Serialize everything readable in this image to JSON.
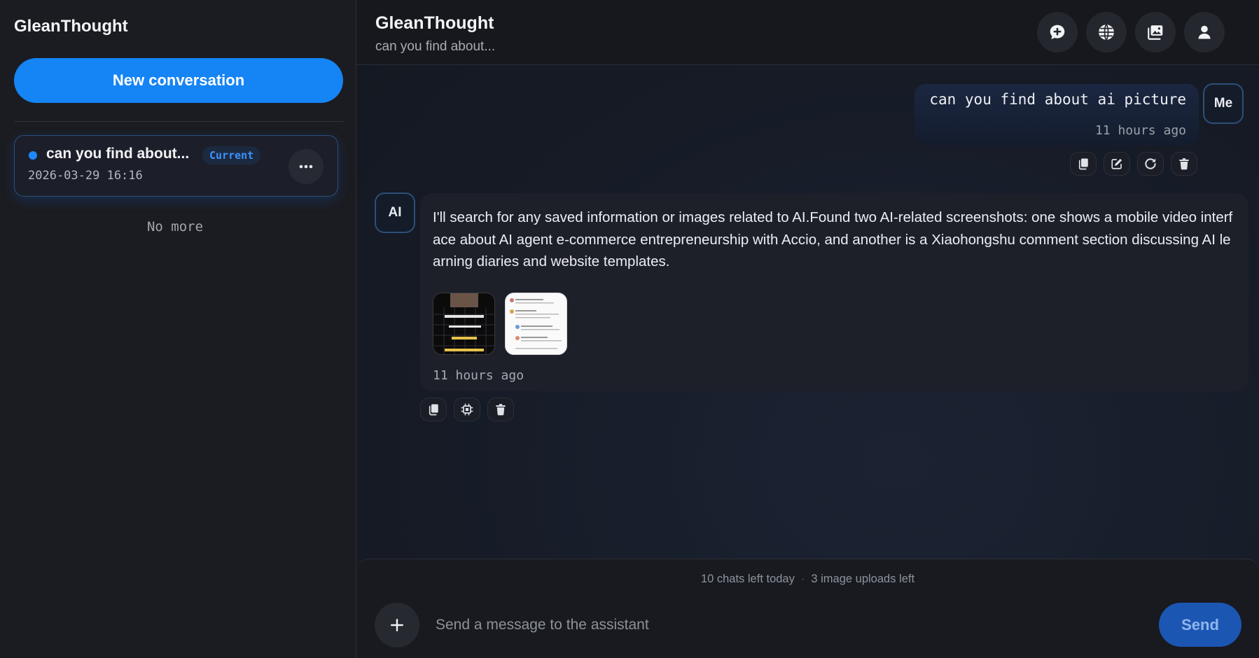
{
  "app": {
    "brand": "GleanThought"
  },
  "sidebar": {
    "new_conversation_label": "New conversation",
    "conversations": [
      {
        "title": "can you find about...",
        "badge": "Current",
        "date": "2026-03-29 16:16"
      }
    ],
    "no_more_label": "No more"
  },
  "header": {
    "title": "GleanThought",
    "subtitle": "can you find about...",
    "icons": [
      "chat-bubble-icon",
      "globe-icon",
      "image-gallery-icon",
      "user-icon"
    ]
  },
  "messages": {
    "user": {
      "avatar_label": "Me",
      "text": "can you find about ai picture",
      "time": "11 hours ago",
      "actions": [
        "copy-icon",
        "edit-icon",
        "regenerate-icon",
        "delete-icon"
      ]
    },
    "ai": {
      "avatar_label": "AI",
      "text": "I'll search for any saved information or images related to AI.Found two AI-related screenshots: one shows a mobile video interface about AI agent e-commerce entrepreneurship with Accio, and another is a Xiaohongshu comment section discussing AI learning diaries and website templates.",
      "attachments": [
        "video-screenshot-thumbnail",
        "comment-screenshot-thumbnail"
      ],
      "time": "11 hours ago",
      "actions": [
        "copy-icon",
        "chip-icon",
        "delete-icon"
      ]
    }
  },
  "composer": {
    "quota_chats": "10 chats left today",
    "quota_separator": "·",
    "quota_images": "3 image uploads left",
    "placeholder": "Send a message to the assistant",
    "send_label": "Send"
  },
  "colors": {
    "accent": "#1584f5",
    "badge_text": "#3d92ff",
    "background": "#1a1c22"
  }
}
